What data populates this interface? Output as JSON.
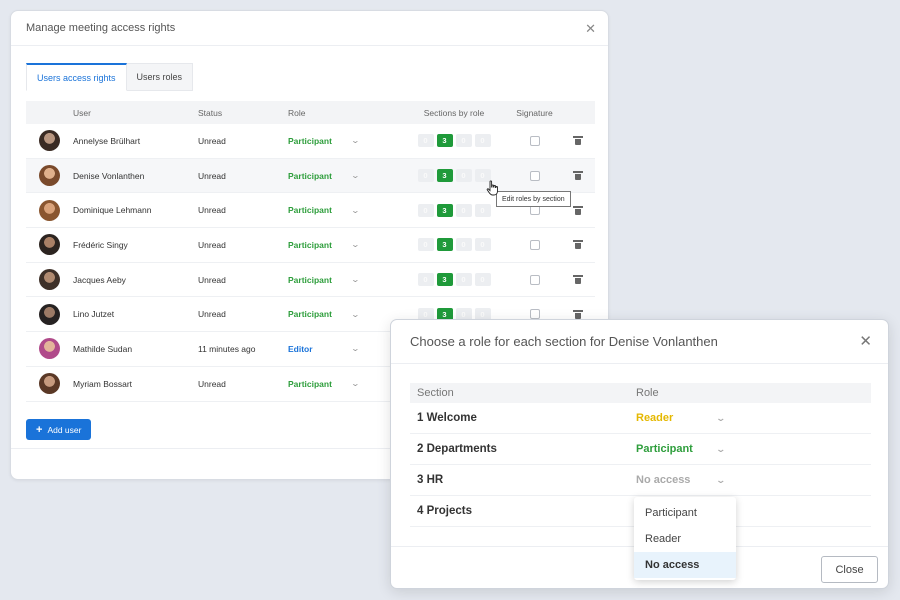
{
  "main_dialog": {
    "title": "Manage meeting access rights",
    "tabs": [
      "Users access rights",
      "Users roles"
    ],
    "columns": {
      "user": "User",
      "status": "Status",
      "role": "Role",
      "sections": "Sections by role",
      "signature": "Signature"
    },
    "rows": [
      {
        "name": "Annelyse Brülhart",
        "status": "Unread",
        "role": "Participant",
        "role_type": "participant",
        "sections": [
          "0",
          "3",
          "0",
          "0"
        ],
        "active": 1
      },
      {
        "name": "Denise Vonlanthen",
        "status": "Unread",
        "role": "Participant",
        "role_type": "participant",
        "sections": [
          "0",
          "3",
          "0",
          "0"
        ],
        "active": 1
      },
      {
        "name": "Dominique Lehmann",
        "status": "Unread",
        "role": "Participant",
        "role_type": "participant",
        "sections": [
          "0",
          "3",
          "0",
          "0"
        ],
        "active": 1
      },
      {
        "name": "Frédéric Singy",
        "status": "Unread",
        "role": "Participant",
        "role_type": "participant",
        "sections": [
          "0",
          "3",
          "0",
          "0"
        ],
        "active": 1
      },
      {
        "name": "Jacques Aeby",
        "status": "Unread",
        "role": "Participant",
        "role_type": "participant",
        "sections": [
          "0",
          "3",
          "0",
          "0"
        ],
        "active": 1
      },
      {
        "name": "Lino Jutzet",
        "status": "Unread",
        "role": "Participant",
        "role_type": "participant",
        "sections": [
          "0",
          "3",
          "0",
          "0"
        ],
        "active": 1
      },
      {
        "name": "Mathilde Sudan",
        "status": "11 minutes ago",
        "role": "Editor",
        "role_type": "editor",
        "sections": [],
        "active": -1
      },
      {
        "name": "Myriam Bossart",
        "status": "Unread",
        "role": "Participant",
        "role_type": "participant",
        "sections": [],
        "active": -1
      }
    ],
    "add_user_label": "Add user",
    "tooltip": "Edit roles by section"
  },
  "role_dialog": {
    "title": "Choose a role for each section for Denise Vonlanthen",
    "columns": {
      "section": "Section",
      "role": "Role"
    },
    "rows": [
      {
        "section": "1 Welcome",
        "role": "Reader",
        "role_type": "reader"
      },
      {
        "section": "2 Departments",
        "role": "Participant",
        "role_type": "participant"
      },
      {
        "section": "3 HR",
        "role": "No access",
        "role_type": "noaccess"
      },
      {
        "section": "4 Projects",
        "role": "",
        "role_type": ""
      }
    ],
    "dropdown_options": [
      "Participant",
      "Reader",
      "No access"
    ],
    "dropdown_selected": "No access",
    "close_label": "Close"
  },
  "colors": {
    "accent": "#1a73d9",
    "participant": "#2e9e3c",
    "reader": "#e5b800",
    "no_access": "#aaaaaa"
  }
}
